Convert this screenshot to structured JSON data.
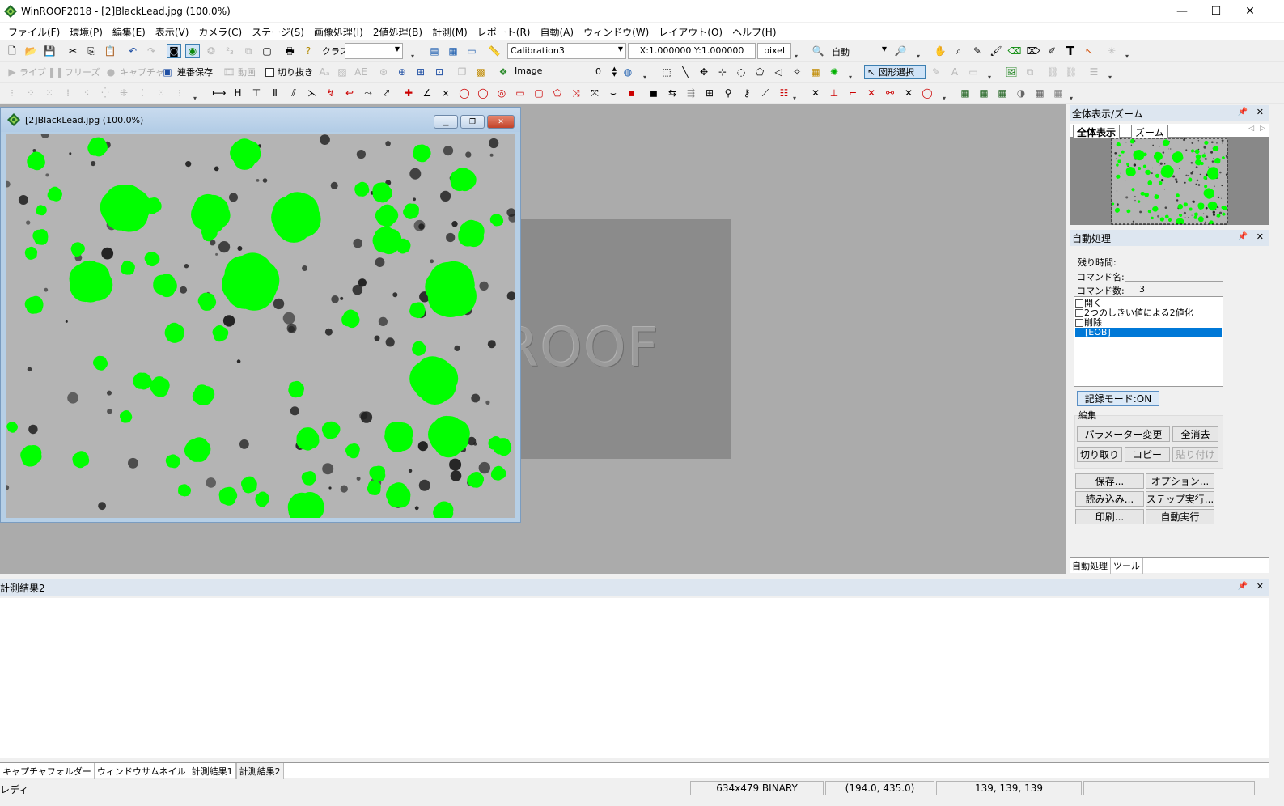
{
  "window": {
    "title": "WinROOF2018 - [2]BlackLead.jpg (100.0%)",
    "minimize": "—",
    "maximize": "☐",
    "close": "✕"
  },
  "menu": [
    "ファイル(F)",
    "環境(P)",
    "編集(E)",
    "表示(V)",
    "カメラ(C)",
    "ステージ(S)",
    "画像処理(I)",
    "2値処理(B)",
    "計測(M)",
    "レポート(R)",
    "自動(A)",
    "ウィンドウ(W)",
    "レイアウト(O)",
    "ヘルプ(H)"
  ],
  "toolbar1": {
    "class_label": "クラス",
    "class_value": "",
    "calibration": "Calibration3",
    "scale": "X:1.000000 Y:1.000000",
    "unit": "pixel",
    "zoom_mode": "自動"
  },
  "toolbar2": {
    "live": "ライブ",
    "freeze": "フリーズ",
    "capture": "キャプチャ",
    "serial_save": "連番保存",
    "video": "動画",
    "crop": "切り抜き",
    "layer": "Image",
    "layer_index": "0",
    "shape_select": "図形選択"
  },
  "child_window": {
    "title": "[2]BlackLead.jpg (100.0%)"
  },
  "splash": {
    "logo_text": "ROOF"
  },
  "overview_pane": {
    "title": "全体表示/ズーム",
    "tabs": [
      "全体表示",
      "ズーム"
    ]
  },
  "auto_pane": {
    "title": "自動処理",
    "remaining_label": "残り時間:",
    "command_name_label": "コマンド名:",
    "command_name_value": "",
    "command_count_label": "コマンド数:",
    "command_count_value": "3",
    "commands": [
      "開く",
      "2つのしきい値による2値化",
      "削除",
      "[EOB]"
    ],
    "record_mode": "記録モード:ON",
    "edit_label": "編集",
    "buttons": {
      "param_change": "パラメーター変更",
      "clear_all": "全消去",
      "cut": "切り取り",
      "copy": "コピー",
      "paste": "貼り付け",
      "save": "保存...",
      "options": "オプション...",
      "load": "読み込み...",
      "step_run": "ステップ実行...",
      "print": "印刷...",
      "auto_run": "自動実行"
    },
    "tabs": [
      "自動処理",
      "ツール"
    ]
  },
  "results_pane": {
    "title": "計測結果2",
    "tabs": [
      "キャプチャフォルダー",
      "ウィンドウサムネイル",
      "計測結果1",
      "計測結果2"
    ]
  },
  "status": {
    "text": "レディ",
    "image_info": "634x479 BINARY",
    "cursor_pos": "(194.0, 435.0)",
    "pixel_value": "139, 139, 139"
  },
  "colors": {
    "binary_overlay": "#00ff00",
    "selection": "#0078d7",
    "mdi_background": "#ababab"
  }
}
